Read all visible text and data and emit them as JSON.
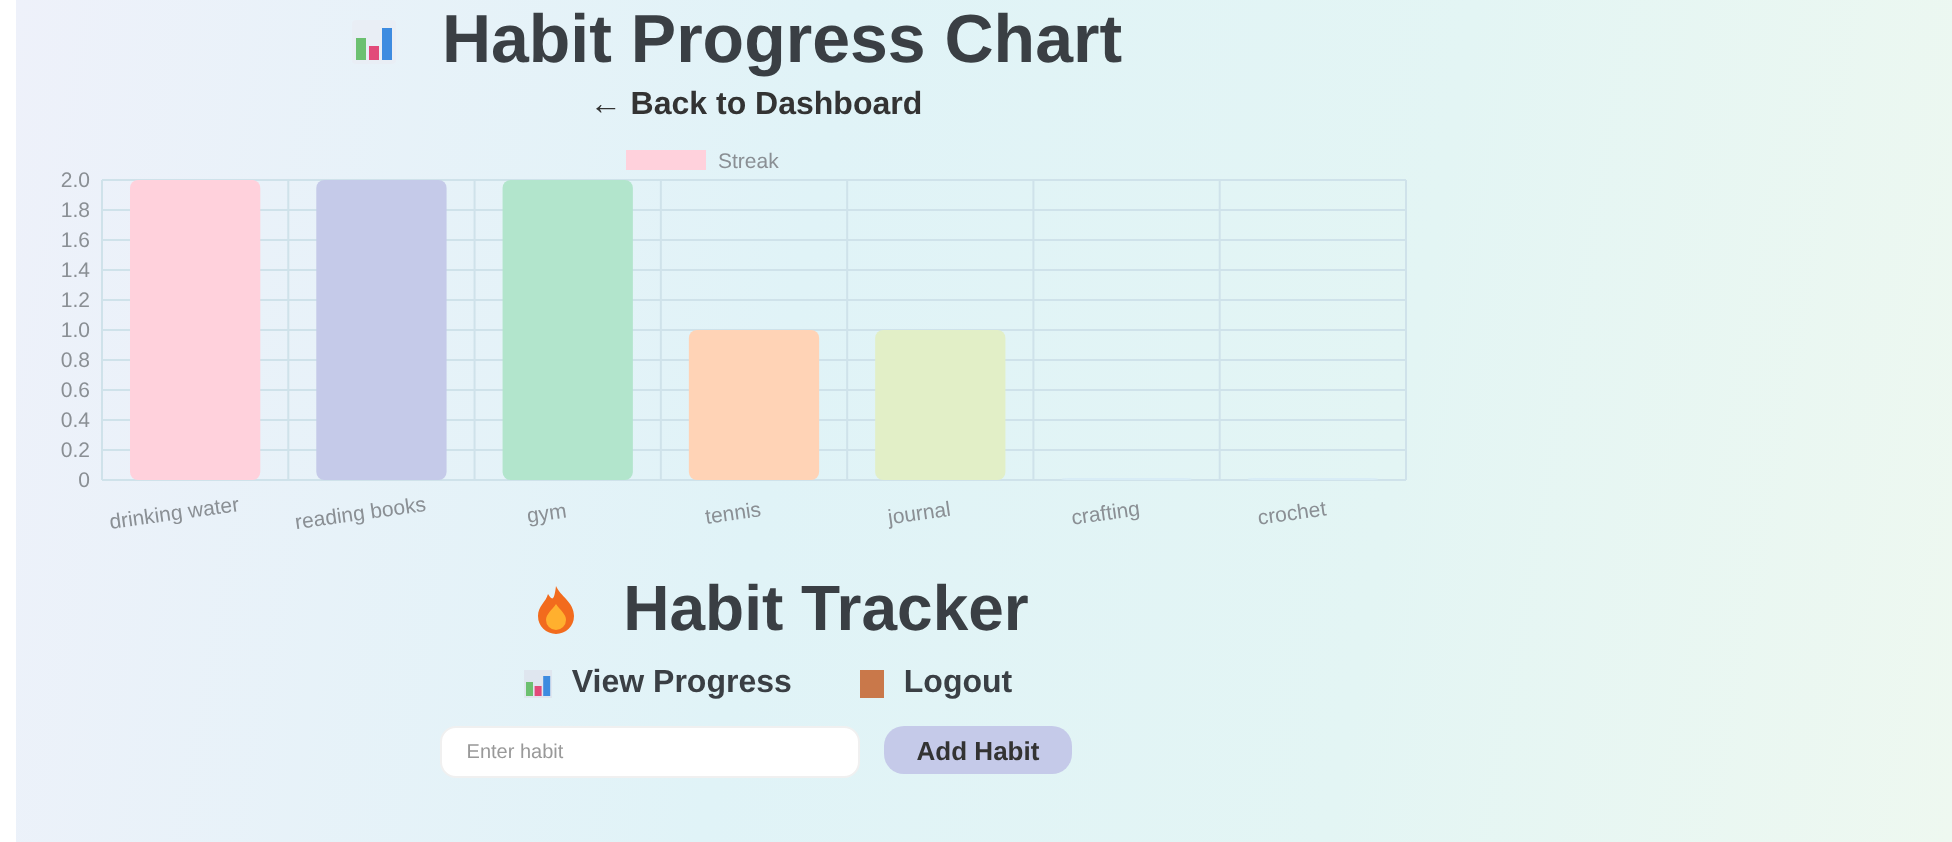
{
  "chart_page": {
    "title": "Habit Progress Chart",
    "back_link": "← Back to Dashboard",
    "chart": {
      "chart_data": {
        "type": "bar",
        "categories": [
          "drinking water",
          "reading books",
          "gym",
          "tennis",
          "journal",
          "crafting",
          "crochet"
        ],
        "series": [
          {
            "name": "Streak",
            "color": "#ffd1dc",
            "values": [
              2,
              2,
              2,
              1,
              1,
              0,
              0
            ],
            "colors": [
              "#ffd1dc",
              "#c5cae9",
              "#b2e5cc",
              "#ffd3b6",
              "#e2efc7",
              "#d8ecf6",
              "#d8ecf6"
            ]
          }
        ],
        "grid": true,
        "ylim": [
          0,
          2
        ],
        "yticks": [
          {
            "value": 0,
            "label": "0"
          },
          {
            "value": 0.2,
            "label": "0.2"
          },
          {
            "value": 0.4,
            "label": "0.4"
          },
          {
            "value": 0.6,
            "label": "0.6"
          },
          {
            "value": 0.8,
            "label": "0.8"
          },
          {
            "value": 1,
            "label": "1.0"
          },
          {
            "value": 1.2,
            "label": "1.2"
          },
          {
            "value": 1.4,
            "label": "1.4"
          },
          {
            "value": 1.6,
            "label": "1.6"
          },
          {
            "value": 1.8,
            "label": "1.8"
          },
          {
            "value": 2,
            "label": "2.0"
          }
        ]
      }
    }
  },
  "tracker": {
    "title": "Habit Tracker",
    "nav": [
      {
        "kind": "progress",
        "label": "View Progress"
      },
      {
        "kind": "logout",
        "label": "Logout"
      }
    ],
    "habit_field": {
      "placeholder": "Enter habit"
    },
    "add_button": "Add Habit"
  }
}
